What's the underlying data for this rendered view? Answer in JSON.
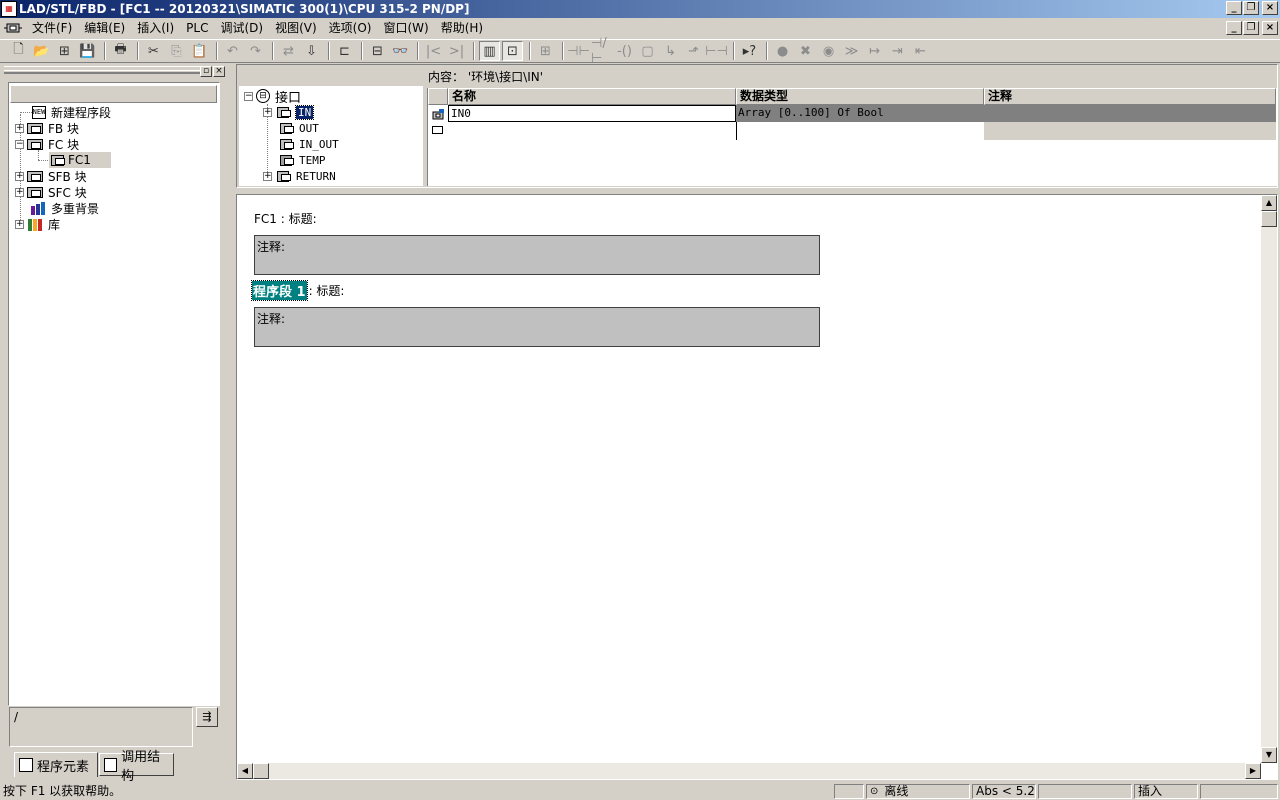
{
  "title": "LAD/STL/FBD  - [FC1 -- 20120321\\SIMATIC 300(1)\\CPU 315-2 PN/DP]",
  "menu": [
    "文件(F)",
    "编辑(E)",
    "插入(I)",
    "PLC",
    "调试(D)",
    "视图(V)",
    "选项(O)",
    "窗口(W)",
    "帮助(H)"
  ],
  "left_tree": {
    "items": [
      {
        "label": "新建程序段"
      },
      {
        "label": "FB 块"
      },
      {
        "label": "FC 块"
      },
      {
        "label": "FC1"
      },
      {
        "label": "SFB 块"
      },
      {
        "label": "SFC 块"
      },
      {
        "label": "多重背景"
      },
      {
        "label": "库"
      }
    ],
    "input_value": "/"
  },
  "left_tabs": [
    "程序元素",
    "调用结构"
  ],
  "interface": {
    "root": "接口",
    "items": [
      "IN",
      "OUT",
      "IN_OUT",
      "TEMP",
      "RETURN"
    ],
    "content_label": "内容：  '环境\\接口\\IN'",
    "columns": [
      "名称",
      "数据类型",
      "注释"
    ],
    "rows": [
      {
        "name": "IN0",
        "type": "Array [0..100] Of Bool",
        "comment": ""
      }
    ]
  },
  "editor": {
    "block_title": "FC1 : 标题:",
    "block_comment": "注释:",
    "network_label": "程序段  1",
    "network_title": ": 标题:",
    "network_comment": "注释:"
  },
  "status": {
    "help": "按下 F1 以获取帮助。",
    "mode": "离线",
    "version": "Abs < 5.2",
    "insert": "插入"
  },
  "colors": {
    "titlebar_start": "#0a246a",
    "titlebar_end": "#a6caf0",
    "face": "#d4d0c8",
    "network_highlight": "#008080"
  }
}
